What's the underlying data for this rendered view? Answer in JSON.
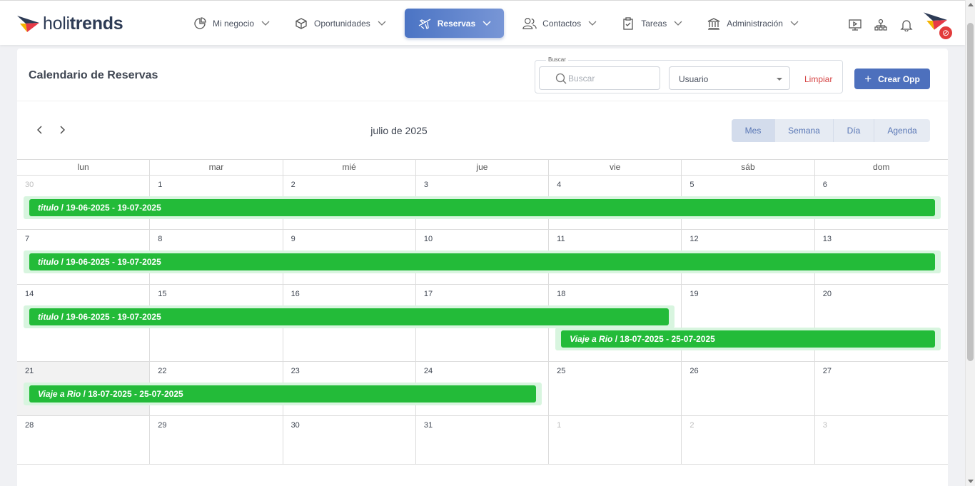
{
  "app": {
    "logo_text_light": "holi",
    "logo_text_bold": "trends",
    "avatar_badge": "⊘"
  },
  "nav": [
    {
      "label": "Mi negocio",
      "icon": "pie-chart-icon",
      "active": false
    },
    {
      "label": "Oportunidades",
      "icon": "box-icon",
      "active": false
    },
    {
      "label": "Reservas",
      "icon": "airplane-icon",
      "active": true
    },
    {
      "label": "Contactos",
      "icon": "users-icon",
      "active": false
    },
    {
      "label": "Tareas",
      "icon": "clipboard-check-icon",
      "active": false
    },
    {
      "label": "Administración",
      "icon": "bank-icon",
      "active": false
    }
  ],
  "tools": [
    "presentation-icon",
    "org-chart-icon",
    "bell-icon"
  ],
  "page": {
    "title": "Calendario de Reservas",
    "filter_legend": "Buscar",
    "search_placeholder": "Buscar",
    "user_select_value": "Usuario",
    "clear_label": "Limpiar",
    "create_label": "Crear Opp"
  },
  "calendar": {
    "month_label": "julio de 2025",
    "views": [
      {
        "label": "Mes",
        "active": true
      },
      {
        "label": "Semana",
        "active": false
      },
      {
        "label": "Día",
        "active": false
      },
      {
        "label": "Agenda",
        "active": false
      }
    ],
    "weekdays": [
      "lun",
      "mar",
      "mié",
      "jue",
      "vie",
      "sáb",
      "dom"
    ],
    "weeks": [
      {
        "days": [
          {
            "n": "30",
            "muted": true
          },
          {
            "n": "1"
          },
          {
            "n": "2"
          },
          {
            "n": "3"
          },
          {
            "n": "4"
          },
          {
            "n": "5"
          },
          {
            "n": "6"
          }
        ],
        "events": [
          {
            "title": "titulo",
            "dates": " / 19-06-2025 - 19-07-2025",
            "start": 0,
            "span": 7,
            "lane": 0
          }
        ]
      },
      {
        "days": [
          {
            "n": "7"
          },
          {
            "n": "8"
          },
          {
            "n": "9"
          },
          {
            "n": "10"
          },
          {
            "n": "11"
          },
          {
            "n": "12"
          },
          {
            "n": "13"
          }
        ],
        "events": [
          {
            "title": "titulo",
            "dates": " / 19-06-2025 - 19-07-2025",
            "start": 0,
            "span": 7,
            "lane": 0
          }
        ]
      },
      {
        "days": [
          {
            "n": "14"
          },
          {
            "n": "15"
          },
          {
            "n": "16"
          },
          {
            "n": "17"
          },
          {
            "n": "18"
          },
          {
            "n": "19"
          },
          {
            "n": "20"
          }
        ],
        "events": [
          {
            "title": "titulo",
            "dates": " / 19-06-2025 - 19-07-2025",
            "start": 0,
            "span": 5,
            "lane": 0
          },
          {
            "title": "Viaje a Rio",
            "dates": " / 18-07-2025 - 25-07-2025",
            "start": 4,
            "span": 3,
            "lane": 1
          }
        ]
      },
      {
        "days": [
          {
            "n": "21",
            "today": true
          },
          {
            "n": "22"
          },
          {
            "n": "23"
          },
          {
            "n": "24"
          },
          {
            "n": "25"
          },
          {
            "n": "26"
          },
          {
            "n": "27"
          }
        ],
        "events": [
          {
            "title": "Viaje a Rio",
            "dates": " / 18-07-2025 - 25-07-2025",
            "start": 0,
            "span": 4,
            "lane": 0
          }
        ]
      },
      {
        "days": [
          {
            "n": "28"
          },
          {
            "n": "29"
          },
          {
            "n": "30"
          },
          {
            "n": "31"
          },
          {
            "n": "1",
            "muted": true
          },
          {
            "n": "2",
            "muted": true
          },
          {
            "n": "3",
            "muted": true
          }
        ],
        "events": []
      }
    ]
  },
  "colors": {
    "accent": "#4d70bd",
    "event_green": "#23bb39",
    "event_bg": "#d8f5df",
    "danger": "#d64545"
  }
}
